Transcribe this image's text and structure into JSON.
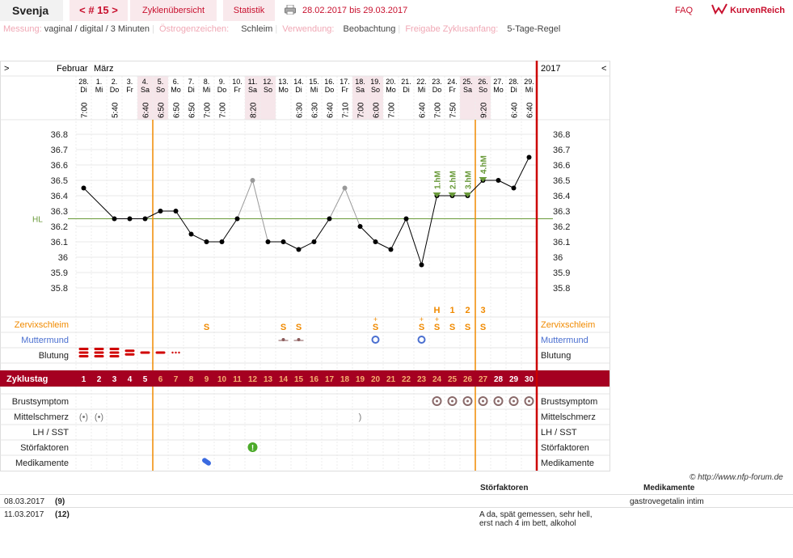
{
  "header": {
    "user": "Svenja",
    "cycle_nav": "< # 15 >",
    "tab_overview": "Zyklenübersicht",
    "tab_stats": "Statistik",
    "period": "28.02.2017 bis 29.03.2017",
    "faq": "FAQ",
    "brand": "KurvenReich"
  },
  "info": {
    "messung_label": "Messung:",
    "messung_value": "vaginal / digital / 3 Minuten",
    "oestrogen_label": "Östrogenzeichen:",
    "oestrogen_value": "Schleim",
    "verwendung_label": "Verwendung:",
    "verwendung_value": "Beobachtung",
    "freigabe_label": "Freigabe Zyklusanfang:",
    "freigabe_value": "5-Tage-Regel"
  },
  "chart_data": {
    "type": "line",
    "month_left": "Februar",
    "month_mid": "März",
    "year_right": "2017",
    "nav_left": ">",
    "nav_right": "<",
    "dates": [
      "28.",
      "1.",
      "2.",
      "3.",
      "4.",
      "5.",
      "6.",
      "7.",
      "8.",
      "9.",
      "10.",
      "11.",
      "12.",
      "13.",
      "14.",
      "15.",
      "16.",
      "17.",
      "18.",
      "19.",
      "20.",
      "21.",
      "22.",
      "23.",
      "24.",
      "25.",
      "26.",
      "27.",
      "28.",
      "29."
    ],
    "weekdays": [
      "Di",
      "Mi",
      "Do",
      "Fr",
      "Sa",
      "So",
      "Mo",
      "Di",
      "Mi",
      "Do",
      "Fr",
      "Sa",
      "So",
      "Mo",
      "Di",
      "Mi",
      "Do",
      "Fr",
      "Sa",
      "So",
      "Mo",
      "Di",
      "Mi",
      "Do",
      "Fr",
      "Sa",
      "So",
      "Mo",
      "Di",
      "Mi"
    ],
    "times": [
      "7:00",
      "",
      "5:40",
      "",
      "6:40",
      "6:50",
      "6:50",
      "6:50",
      "7:00",
      "7:00",
      "",
      "8:20",
      "",
      "",
      "6:30",
      "6:30",
      "6:40",
      "7:10",
      "7:00",
      "6:00",
      "7:00",
      "",
      "6:40",
      "7:00",
      "7:50",
      "",
      "9:20",
      "",
      "6:40",
      "6:40"
    ],
    "weekend_days": [
      5,
      6,
      12,
      13,
      19,
      20,
      26,
      27
    ],
    "cycle_days": [
      1,
      2,
      3,
      4,
      5,
      6,
      7,
      8,
      9,
      10,
      11,
      12,
      13,
      14,
      15,
      16,
      17,
      18,
      19,
      20,
      21,
      22,
      23,
      24,
      25,
      26,
      27,
      28,
      29,
      30
    ],
    "temperatures": [
      36.45,
      null,
      36.25,
      36.25,
      36.25,
      36.3,
      36.3,
      36.15,
      36.1,
      36.1,
      36.25,
      36.5,
      36.1,
      36.1,
      36.05,
      36.1,
      36.25,
      36.45,
      36.2,
      36.1,
      36.05,
      36.25,
      35.95,
      36.4,
      36.4,
      36.4,
      36.5,
      36.5,
      36.45,
      36.65
    ],
    "excluded_days": [
      12,
      18
    ],
    "y_ticks": [
      36.8,
      36.7,
      36.6,
      36.5,
      36.4,
      36.3,
      36.2,
      36.1,
      36,
      35.9,
      35.8
    ],
    "y_tick_labels": [
      "36.8",
      "36.7",
      "36.6",
      "36.5",
      "36.4",
      "36.3",
      "36.2",
      "36.1",
      "36",
      "35.9",
      "35.8"
    ],
    "ylim": [
      35.75,
      36.85
    ],
    "coverline": 36.25,
    "coverline_label": "HL",
    "high_markers": [
      {
        "day": 24,
        "label": "1.hM"
      },
      {
        "day": 25,
        "label": "2.hM"
      },
      {
        "day": 26,
        "label": "3.hM"
      },
      {
        "day": 27,
        "label": "4.hM"
      }
    ],
    "marker_lines": [
      5.5,
      26.5
    ],
    "mucus_highlights": [
      {
        "day": 24,
        "label": "H"
      },
      {
        "day": 25,
        "label": "1"
      },
      {
        "day": 26,
        "label": "2"
      },
      {
        "day": 27,
        "label": "3"
      }
    ],
    "mucus": [
      {
        "day": 9,
        "label": "S"
      },
      {
        "day": 14,
        "label": "S"
      },
      {
        "day": 15,
        "label": "S"
      },
      {
        "day": 20,
        "label": "S+"
      },
      {
        "day": 23,
        "label": "S+"
      },
      {
        "day": 24,
        "label": "S+"
      },
      {
        "day": 25,
        "label": "S"
      },
      {
        "day": 26,
        "label": "S"
      },
      {
        "day": 27,
        "label": "S"
      }
    ],
    "cervix": [
      14,
      15,
      20,
      23
    ],
    "bleeding": [
      {
        "day": 1,
        "level": 3
      },
      {
        "day": 2,
        "level": 3
      },
      {
        "day": 3,
        "level": 3
      },
      {
        "day": 4,
        "level": 2
      },
      {
        "day": 5,
        "level": 1
      },
      {
        "day": 6,
        "level": 1
      },
      {
        "day": 7,
        "level": 0
      }
    ],
    "breast": [
      24,
      25,
      26,
      27,
      28,
      29,
      30
    ],
    "midpain": [
      1,
      2,
      19
    ],
    "disturbance": [
      12
    ],
    "medication": [
      9
    ],
    "rows": {
      "mucus": "Zervixschleim",
      "cervix": "Muttermund",
      "bleeding": "Blutung",
      "cycleday": "Zyklustag",
      "breast": "Brustsymptom",
      "midpain": "Mittelschmerz",
      "lh": "LH / SST",
      "disturb": "Störfaktoren",
      "meds": "Medikamente"
    }
  },
  "copyright": "© http://www.nfp-forum.de",
  "notes": {
    "col_stoer": "Störfaktoren",
    "col_med": "Medikamente",
    "rows": [
      {
        "date": "08.03.2017",
        "day": "(9)",
        "stoer": "",
        "med": "gastrovegetalin intim"
      },
      {
        "date": "11.03.2017",
        "day": "(12)",
        "stoer": "A da, spät gemessen, sehr hell, erst nach 4 im bett, alkohol",
        "med": ""
      }
    ]
  },
  "colors": {
    "accent": "#c8102e",
    "coverline": "#6a9a3a",
    "marker": "#f08a00",
    "mucus": "#f08a00",
    "cervix": "#4a6fd0",
    "bleeding": "#d00000",
    "bar": "#a50021"
  }
}
